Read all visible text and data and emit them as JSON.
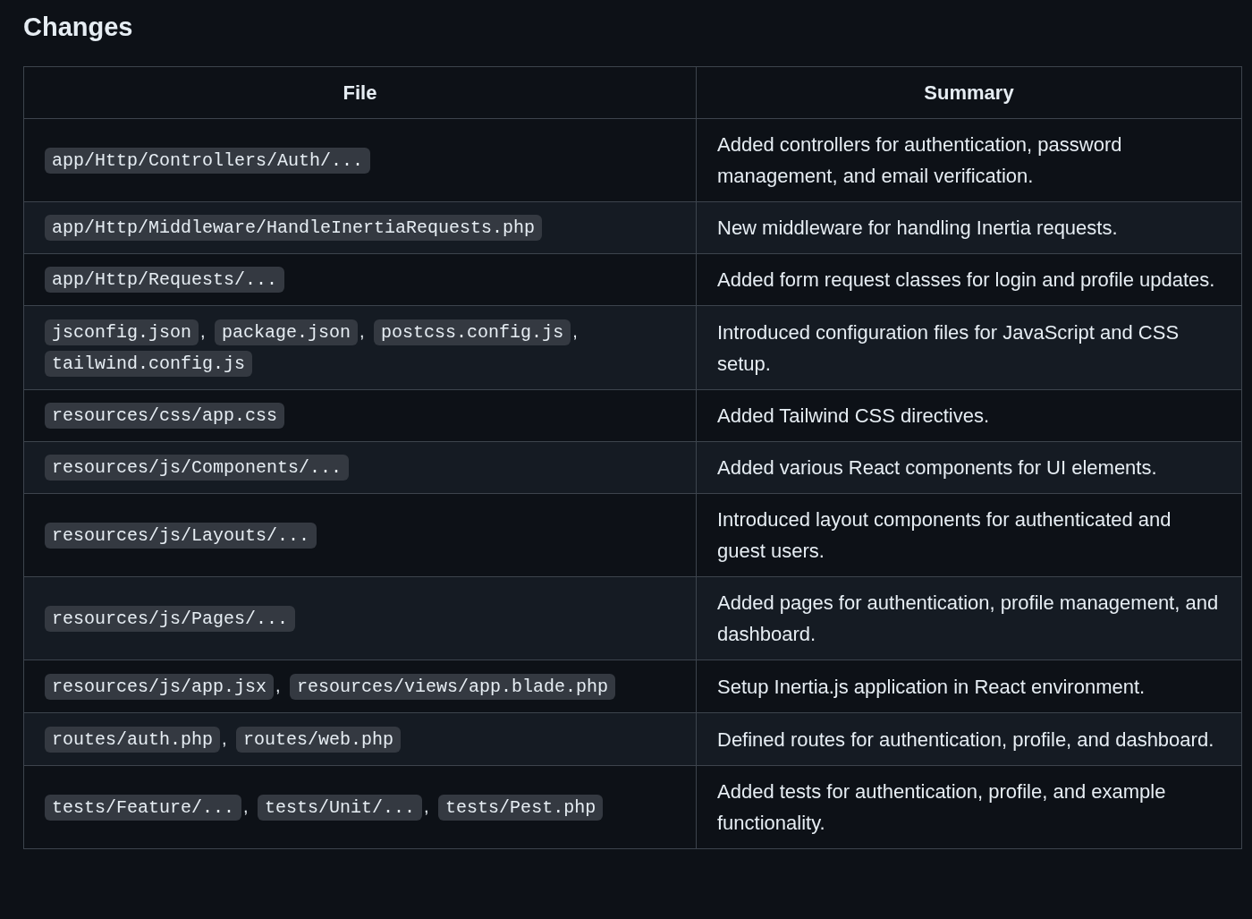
{
  "heading": "Changes",
  "table": {
    "columns": [
      "File",
      "Summary"
    ],
    "rows": [
      {
        "files": [
          {
            "path": "app/Http/Controllers/Auth/..."
          }
        ],
        "summary": "Added controllers for authentication, password management, and email verification."
      },
      {
        "files": [
          {
            "path": "app/Http/Middleware/HandleInertiaRequests.php"
          }
        ],
        "summary": "New middleware for handling Inertia requests."
      },
      {
        "files": [
          {
            "path": "app/Http/Requests/..."
          }
        ],
        "summary": "Added form request classes for login and profile updates."
      },
      {
        "files": [
          {
            "path": "jsconfig.json",
            "trail": ","
          },
          {
            "path": "package.json",
            "trail": ","
          },
          {
            "path": "postcss.config.js",
            "trail": ","
          },
          {
            "path": "tailwind.config.js"
          }
        ],
        "summary": "Introduced configuration files for JavaScript and CSS setup."
      },
      {
        "files": [
          {
            "path": "resources/css/app.css"
          }
        ],
        "summary": "Added Tailwind CSS directives."
      },
      {
        "files": [
          {
            "path": "resources/js/Components/..."
          }
        ],
        "summary": "Added various React components for UI elements."
      },
      {
        "files": [
          {
            "path": "resources/js/Layouts/..."
          }
        ],
        "summary": "Introduced layout components for authenticated and guest users."
      },
      {
        "files": [
          {
            "path": "resources/js/Pages/..."
          }
        ],
        "summary": "Added pages for authentication, profile management, and dashboard."
      },
      {
        "files": [
          {
            "path": "resources/js/app.jsx",
            "trail": ","
          },
          {
            "path": "resources/views/app.blade.php"
          }
        ],
        "summary": "Setup Inertia.js application in React environment."
      },
      {
        "files": [
          {
            "path": "routes/auth.php",
            "trail": ","
          },
          {
            "path": "routes/web.php"
          }
        ],
        "summary": "Defined routes for authentication, profile, and dashboard."
      },
      {
        "files": [
          {
            "path": "tests/Feature/...",
            "trail": ","
          },
          {
            "path": "tests/Unit/...",
            "trail": ","
          },
          {
            "path": "tests/Pest.php"
          }
        ],
        "summary": "Added tests for authentication, profile, and example functionality."
      }
    ]
  }
}
